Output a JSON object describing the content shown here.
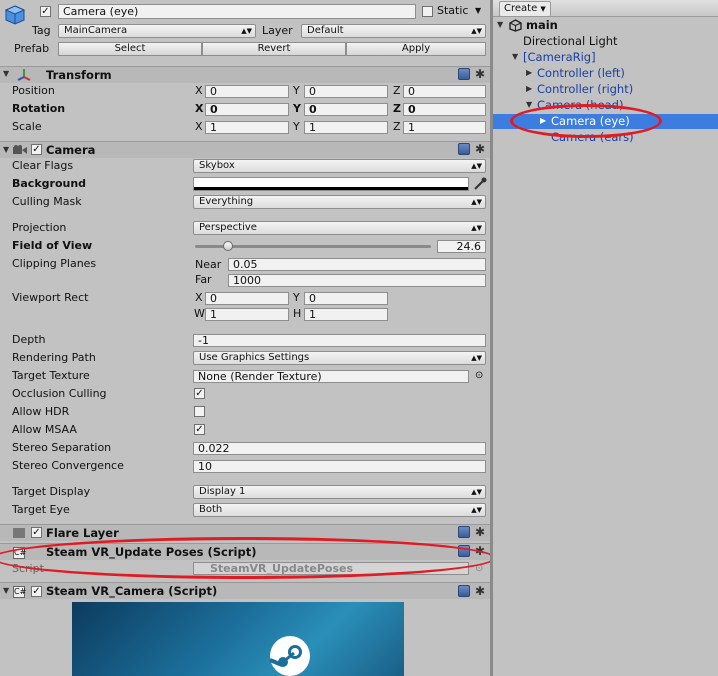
{
  "header": {
    "object_name": "Camera (eye)",
    "static_label": "Static",
    "tag_label": "Tag",
    "tag_value": "MainCamera",
    "layer_label": "Layer",
    "layer_value": "Default",
    "prefab_label": "Prefab",
    "select_label": "Select",
    "revert_label": "Revert",
    "apply_label": "Apply"
  },
  "transform": {
    "title": "Transform",
    "position_label": "Position",
    "rotation_label": "Rotation",
    "scale_label": "Scale",
    "x": "X",
    "y": "Y",
    "z": "Z",
    "position": [
      "0",
      "0",
      "0"
    ],
    "rotation": [
      "0",
      "0",
      "0"
    ],
    "scale": [
      "1",
      "1",
      "1"
    ]
  },
  "camera": {
    "title": "Camera",
    "clear_flags_label": "Clear Flags",
    "clear_flags_value": "Skybox",
    "background_label": "Background",
    "culling_mask_label": "Culling Mask",
    "culling_mask_value": "Everything",
    "projection_label": "Projection",
    "projection_value": "Perspective",
    "fov_label": "Field of View",
    "fov_value": "24.6",
    "fov_fraction": 0.14,
    "clipping_label": "Clipping Planes",
    "near_label": "Near",
    "near_value": "0.05",
    "far_label": "Far",
    "far_value": "1000",
    "viewport_label": "Viewport Rect",
    "vp_x_label": "X",
    "vp_y_label": "Y",
    "vp_w_label": "W",
    "vp_h_label": "H",
    "vp_x": "0",
    "vp_y": "0",
    "vp_w": "1",
    "vp_h": "1",
    "depth_label": "Depth",
    "depth_value": "-1",
    "rendering_path_label": "Rendering Path",
    "rendering_path_value": "Use Graphics Settings",
    "target_texture_label": "Target Texture",
    "target_texture_value": "None (Render Texture)",
    "occlusion_label": "Occlusion Culling",
    "occlusion_checked": true,
    "hdr_label": "Allow HDR",
    "hdr_checked": false,
    "msaa_label": "Allow MSAA",
    "msaa_checked": true,
    "stereo_sep_label": "Stereo Separation",
    "stereo_sep_value": "0.022",
    "stereo_conv_label": "Stereo Convergence",
    "stereo_conv_value": "10",
    "target_display_label": "Target Display",
    "target_display_value": "Display 1",
    "target_eye_label": "Target Eye",
    "target_eye_value": "Both"
  },
  "components": {
    "flare_layer": "Flare Layer",
    "update_poses": "Steam VR_Update Poses (Script)",
    "script_label": "Script",
    "script_value": "SteamVR_UpdatePoses",
    "steamvr_camera": "Steam VR_Camera (Script)"
  },
  "hierarchy": {
    "create_label": "Create",
    "scene_name": "main",
    "items": [
      {
        "label": "Directional Light"
      },
      {
        "label": "[CameraRig]"
      },
      {
        "label": "Controller (left)"
      },
      {
        "label": "Controller (right)"
      },
      {
        "label": "Camera (head)"
      },
      {
        "label": "Camera (eye)"
      },
      {
        "label": "Camera (ears)"
      }
    ]
  },
  "colors": {
    "accent": "#3e7de0",
    "annotation": "#e01b24",
    "prefab_text": "#1a3fa0"
  }
}
